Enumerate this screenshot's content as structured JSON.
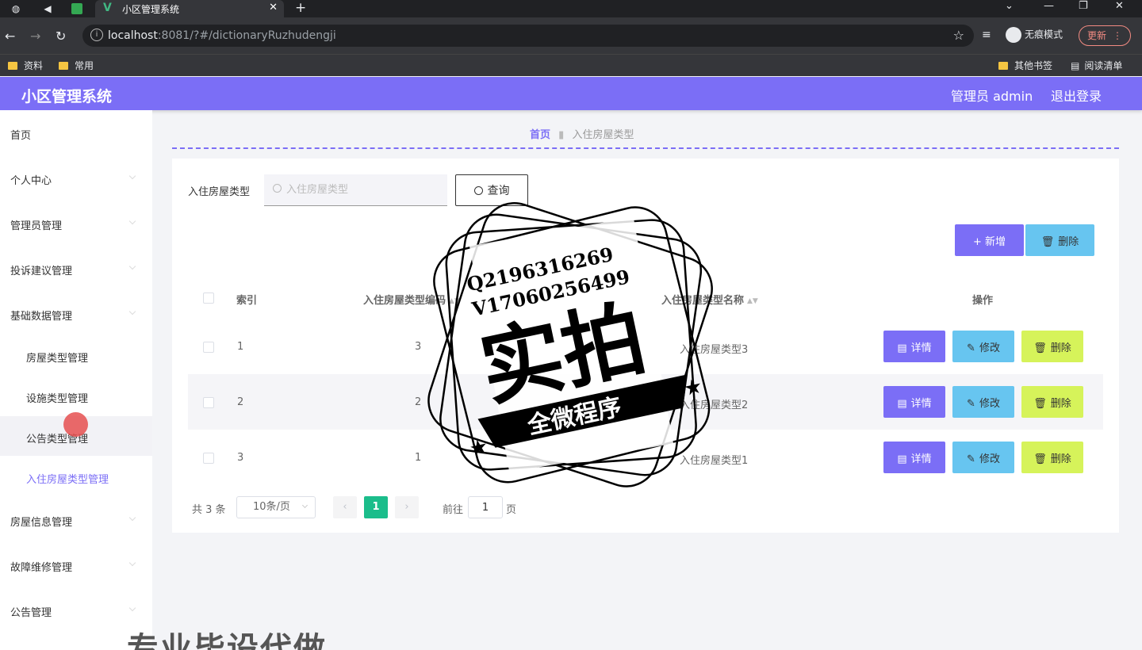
{
  "browser": {
    "tab_title": "小区管理系统",
    "url_host": "localhost",
    "url_rest": ":8081/?#/dictionaryRuzhudengji",
    "incognito_label": "无痕模式",
    "update_label": "更新",
    "bookmarks": [
      "资料",
      "常用"
    ],
    "bookmarks_right": [
      "其他书签",
      "阅读清单"
    ]
  },
  "header": {
    "title": "小区管理系统",
    "admin": "管理员 admin",
    "logout": "退出登录"
  },
  "sidebar": {
    "items": [
      {
        "label": "首页"
      },
      {
        "label": "个人中心"
      },
      {
        "label": "管理员管理"
      },
      {
        "label": "投诉建议管理"
      },
      {
        "label": "基础数据管理"
      },
      {
        "label": "房屋类型管理"
      },
      {
        "label": "设施类型管理"
      },
      {
        "label": "公告类型管理"
      },
      {
        "label": "入住房屋类型管理"
      },
      {
        "label": "房屋信息管理"
      },
      {
        "label": "故障维修管理"
      },
      {
        "label": "公告管理"
      }
    ]
  },
  "breadcrumb": {
    "home": "首页",
    "current": "入住房屋类型"
  },
  "search": {
    "label": "入住房屋类型",
    "placeholder": "入住房屋类型",
    "button": "查询"
  },
  "toolbar": {
    "add": "+ 新增",
    "delete": "删除"
  },
  "table": {
    "columns": [
      "索引",
      "入住房屋类型编码",
      "入住房屋类型名称",
      "操作"
    ],
    "rows": [
      {
        "index": "1",
        "code": "3",
        "name": "入住房屋类型3"
      },
      {
        "index": "2",
        "code": "2",
        "name": "入住房屋类型2"
      },
      {
        "index": "3",
        "code": "1",
        "name": "入住房屋类型1"
      }
    ],
    "actions": {
      "detail": "详情",
      "edit": "修改",
      "delete": "删除"
    }
  },
  "pagination": {
    "total": "共 3 条",
    "page_size": "10条/页",
    "current_page": "1",
    "goto_label": "前往",
    "goto_value": "1",
    "page_suffix": "页"
  },
  "watermark": {
    "line1": "Q2196316269",
    "line2": "V17060256499",
    "main": "实拍",
    "banner": "全微程序",
    "bottom": "专业毕设代做"
  },
  "colors": {
    "primary": "#7b6ef6",
    "info": "#67c5f0",
    "warning": "#d6f35a",
    "pager_active": "#1bbd8b"
  }
}
